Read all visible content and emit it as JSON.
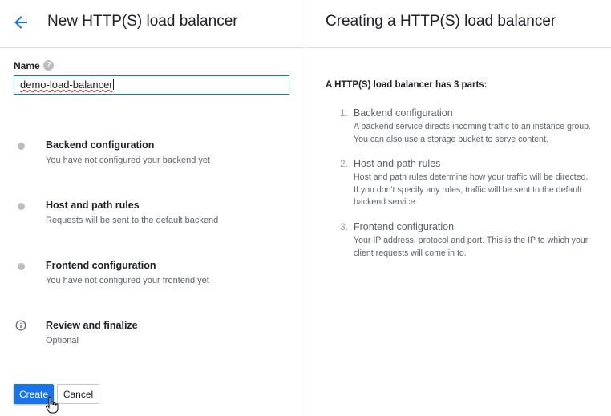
{
  "left": {
    "title": "New HTTP(S) load balancer",
    "name_label": "Name",
    "help_icon_glyph": "?",
    "name_value": "demo-load-balancer",
    "steps": [
      {
        "title": "Backend configuration",
        "subtitle": "You have not configured your backend yet",
        "icon": "status-dot"
      },
      {
        "title": "Host and path rules",
        "subtitle": "Requests will be sent to the default backend",
        "icon": "status-dot"
      },
      {
        "title": "Frontend configuration",
        "subtitle": "You have not configured your frontend yet",
        "icon": "status-dot"
      },
      {
        "title": "Review and finalize",
        "subtitle": "Optional",
        "icon": "info-icon"
      }
    ],
    "create_label": "Create",
    "cancel_label": "Cancel"
  },
  "right": {
    "title": "Creating a HTTP(S) load balancer",
    "intro": "A HTTP(S) load balancer has 3 parts:",
    "parts": [
      {
        "num": "1.",
        "title": "Backend configuration",
        "desc": "A backend service directs incoming traffic to an instance group. You can also use a storage bucket to serve content."
      },
      {
        "num": "2.",
        "title": "Host and path rules",
        "desc": "Host and path rules determine how your traffic will be directed. If you don't specify any rules, traffic will be sent to the default backend service."
      },
      {
        "num": "3.",
        "title": "Frontend configuration",
        "desc": "Your IP address, protocol and port. This is the IP to which your client requests will come in to."
      }
    ]
  },
  "colors": {
    "accent": "#1a73e8",
    "divider": "#dadce0",
    "muted_text": "#5f6368",
    "status_dot": "#bdbdbd"
  }
}
